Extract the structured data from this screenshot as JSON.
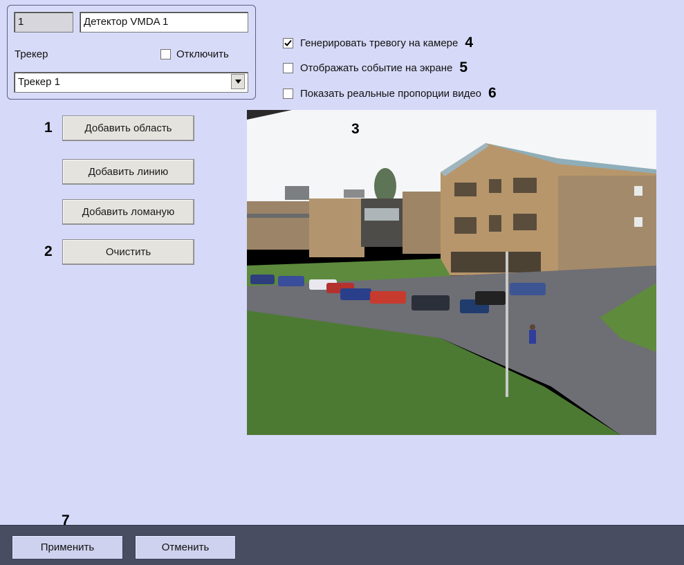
{
  "detector": {
    "id": "1",
    "name": "Детектор VMDA 1",
    "tracker_label": "Трекер",
    "disable_label": "Отключить",
    "disable_checked": false,
    "tracker_selected": "Трекер 1"
  },
  "options": {
    "alarm_label": "Генерировать тревогу на камере",
    "alarm_checked": true,
    "show_event_label": "Отображать событие на экране",
    "show_event_checked": false,
    "real_proportions_label": "Показать реальные пропорции видео",
    "real_proportions_checked": false
  },
  "buttons": {
    "add_area": "Добавить область",
    "add_line": "Добавить линию",
    "add_polyline": "Добавить ломаную",
    "clear": "Очистить",
    "apply": "Применить",
    "cancel": "Отменить"
  },
  "annotations": {
    "n1": "1",
    "n2": "2",
    "n3": "3",
    "n4": "4",
    "n5": "5",
    "n6": "6",
    "n7": "7"
  },
  "icons": {
    "dropdown": "chevron-down-icon",
    "check": "checkmark-icon"
  }
}
